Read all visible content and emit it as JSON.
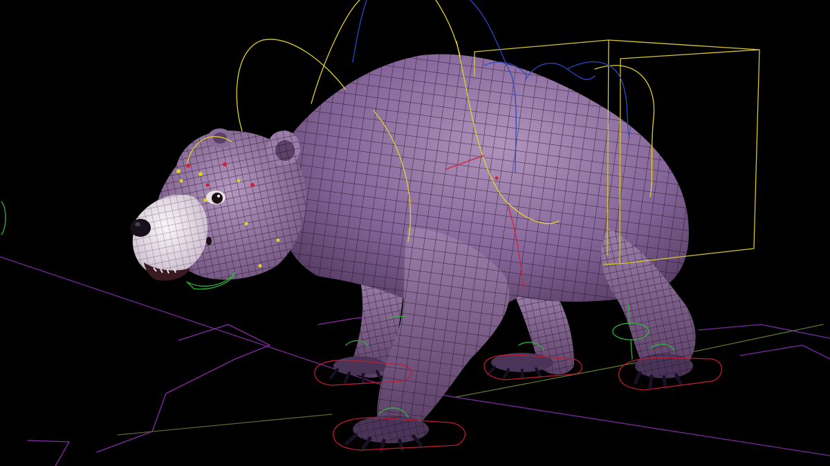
{
  "viewport": {
    "background": "#000000",
    "subject": "rigged-bear-model",
    "mesh_display": "wireframe-on-shaded"
  },
  "colors": {
    "body": "#8a6a98",
    "body_light": "#a888b4",
    "body_shadow": "#4c3358",
    "muzzle": "#e8dde6",
    "wire": "#1a0f1e",
    "ctrl_yellow": "#e2d22a",
    "ctrl_blue": "#2c48c8",
    "ctrl_red": "#d0203a",
    "ctrl_green": "#2fb43a",
    "ctrl_magenta": "#9a3aa8"
  },
  "controls": [
    {
      "name": "head-ik-control",
      "color": "ctrl_yellow"
    },
    {
      "name": "spine-control",
      "color": "ctrl_yellow"
    },
    {
      "name": "hip-box-control",
      "color": "ctrl_yellow"
    },
    {
      "name": "tail-control",
      "color": "ctrl_blue"
    },
    {
      "name": "foot-ik-front-left",
      "color": "ctrl_red"
    },
    {
      "name": "foot-ik-front-right",
      "color": "ctrl_red"
    },
    {
      "name": "foot-ik-back-left",
      "color": "ctrl_red"
    },
    {
      "name": "foot-ik-back-right",
      "color": "ctrl_red"
    },
    {
      "name": "jaw-control",
      "color": "ctrl_green"
    },
    {
      "name": "ground-grid",
      "color": "ctrl_magenta"
    }
  ]
}
